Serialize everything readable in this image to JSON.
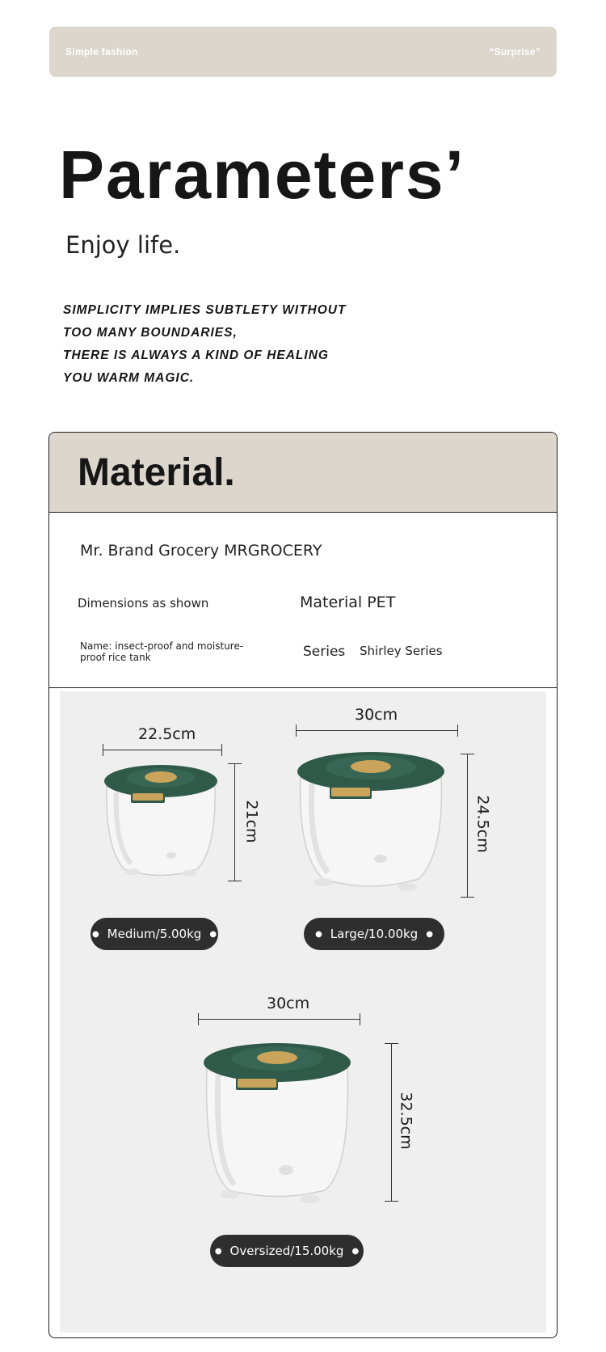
{
  "banner": {
    "left_text": "Simple fashion",
    "right_text": "“Surprise”"
  },
  "title": "Parameters’",
  "subtitle": "Enjoy life.",
  "slogan": [
    "SIMPLICITY IMPLIES SUBTLETY WITHOUT",
    "TOO MANY BOUNDARIES,",
    "THERE IS ALWAYS A KIND OF HEALING",
    "YOU WARM MAGIC."
  ],
  "material": {
    "heading": "Material.",
    "brand": "Mr. Brand Grocery MRGROCERY",
    "dimensions": "Dimensions as shown",
    "material": "Material PET",
    "name": "Name: insect-proof and moisture-proof rice tank",
    "series_label": "Series",
    "series_value": "Shirley Series"
  },
  "products": [
    {
      "width": "22.5cm",
      "height": "21cm",
      "label": "Medium/5.00kg"
    },
    {
      "width": "30cm",
      "height": "24.5cm",
      "label": "Large/10.00kg"
    },
    {
      "width": "30cm",
      "height": "32.5cm",
      "label": "Oversized/15.00kg"
    }
  ],
  "colors": {
    "beige": "#dcd6cc",
    "lid_green": "#2f5a4a",
    "gold": "#c9a45a",
    "pill": "#2e2e2e"
  }
}
